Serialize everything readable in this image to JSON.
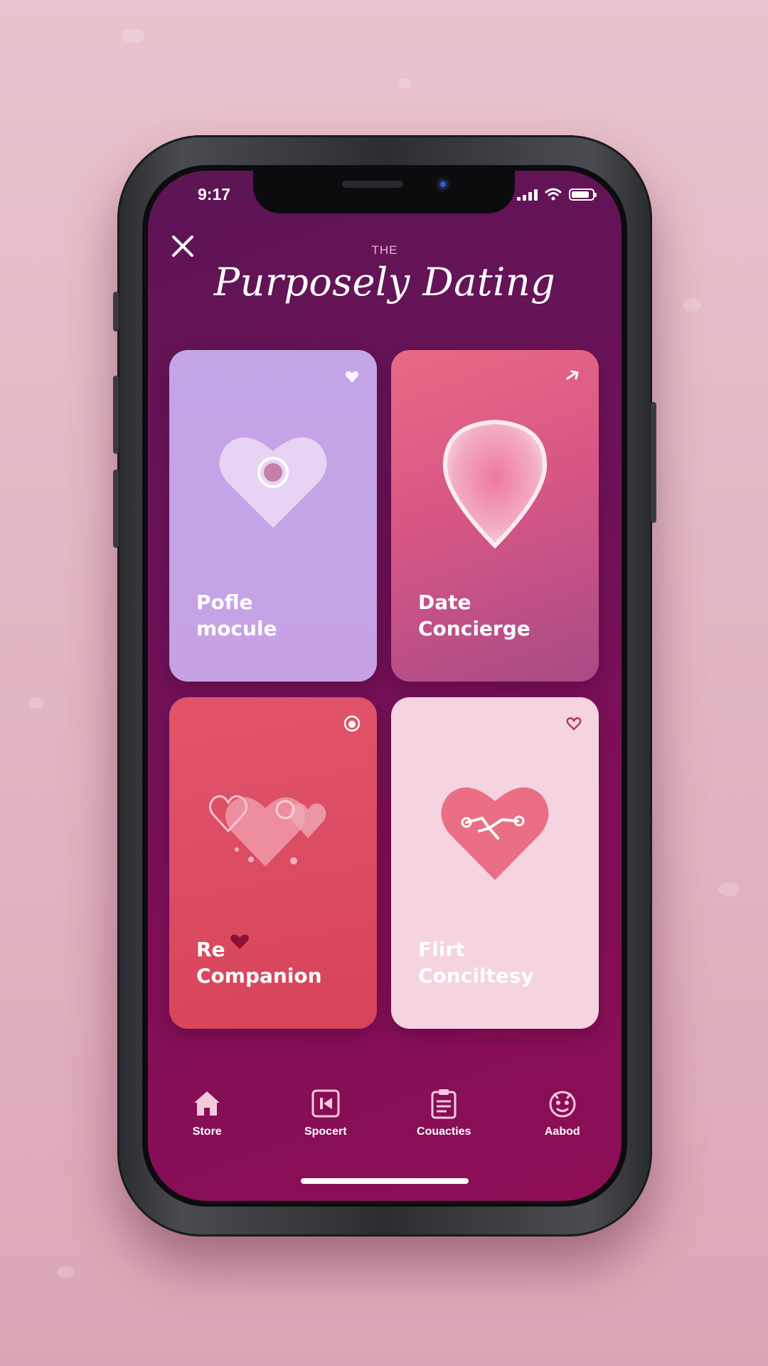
{
  "status_bar": {
    "time": "9:17"
  },
  "header": {
    "prefix": "THE",
    "title": "Purposely Dating"
  },
  "cards": [
    {
      "line1": "Pofle",
      "line2": "mocule"
    },
    {
      "line1": "Date",
      "line2": "Concierge"
    },
    {
      "line1": "Re",
      "line2": "Companion"
    },
    {
      "line1": "Flirt",
      "line2": "Conciltesy"
    }
  ],
  "nav": [
    {
      "label": "Store",
      "icon": "home-icon"
    },
    {
      "label": "Spocert",
      "icon": "media-icon"
    },
    {
      "label": "Couacties",
      "icon": "clipboard-icon"
    },
    {
      "label": "Aabod",
      "icon": "face-icon"
    }
  ],
  "colors": {
    "screen_bg": "#7f0f58",
    "card_lavender": "#c3a5e8",
    "card_rose": "#d75785",
    "card_red": "#d74459",
    "card_pink": "#f6d3e1"
  }
}
